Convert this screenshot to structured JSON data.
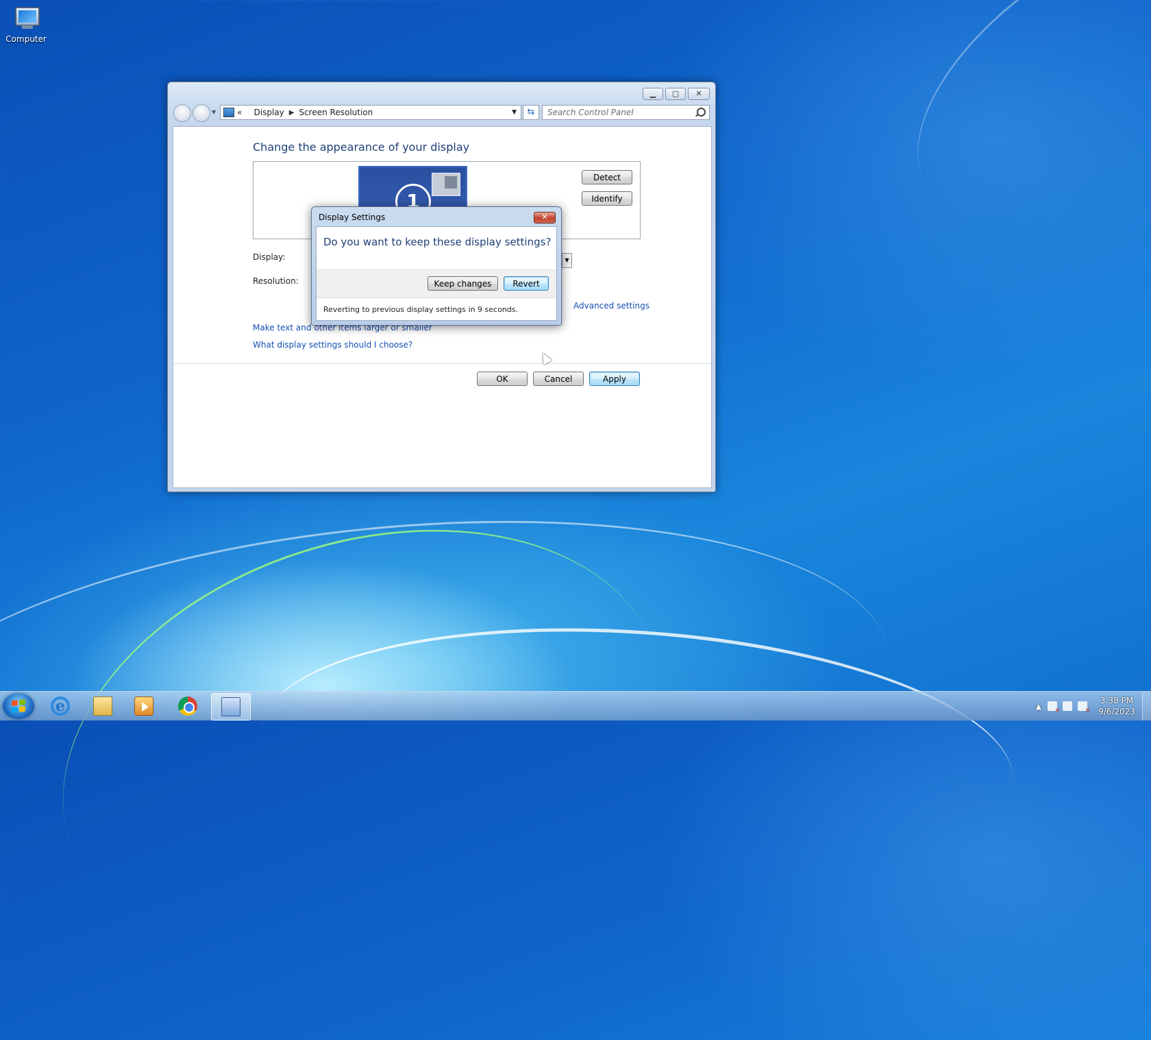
{
  "desktop": {
    "icons": [
      {
        "label": "Computer",
        "icon": "computer-icon"
      }
    ]
  },
  "window": {
    "breadcrumb": {
      "overflow": "«",
      "items": [
        "Display",
        "Screen Resolution"
      ]
    },
    "search": {
      "placeholder": "Search Control Panel"
    },
    "heading": "Change the appearance of your display",
    "monitor_number": "1",
    "detect_label": "Detect",
    "identify_label": "Identify",
    "display_label": "Display:",
    "resolution_label": "Resolution:",
    "advanced_link": "Advanced settings",
    "link_text_size": "Make text and other items larger or smaller",
    "link_help": "What display settings should I choose?",
    "ok_label": "OK",
    "cancel_label": "Cancel",
    "apply_label": "Apply"
  },
  "dialog": {
    "title": "Display Settings",
    "question": "Do you want to keep these display settings?",
    "keep_label": "Keep changes",
    "revert_label": "Revert",
    "countdown": "Reverting to previous display settings in 9 seconds."
  },
  "taskbar": {
    "apps": [
      "internet-explorer",
      "windows-explorer",
      "media-player",
      "chrome",
      "control-panel"
    ],
    "active_app": "control-panel",
    "clock": {
      "time": "3:38 PM",
      "date": "9/6/2023"
    }
  },
  "colors": {
    "accent": "#1e3f78",
    "link": "#1550b5",
    "desktop": "#0f66cc"
  }
}
